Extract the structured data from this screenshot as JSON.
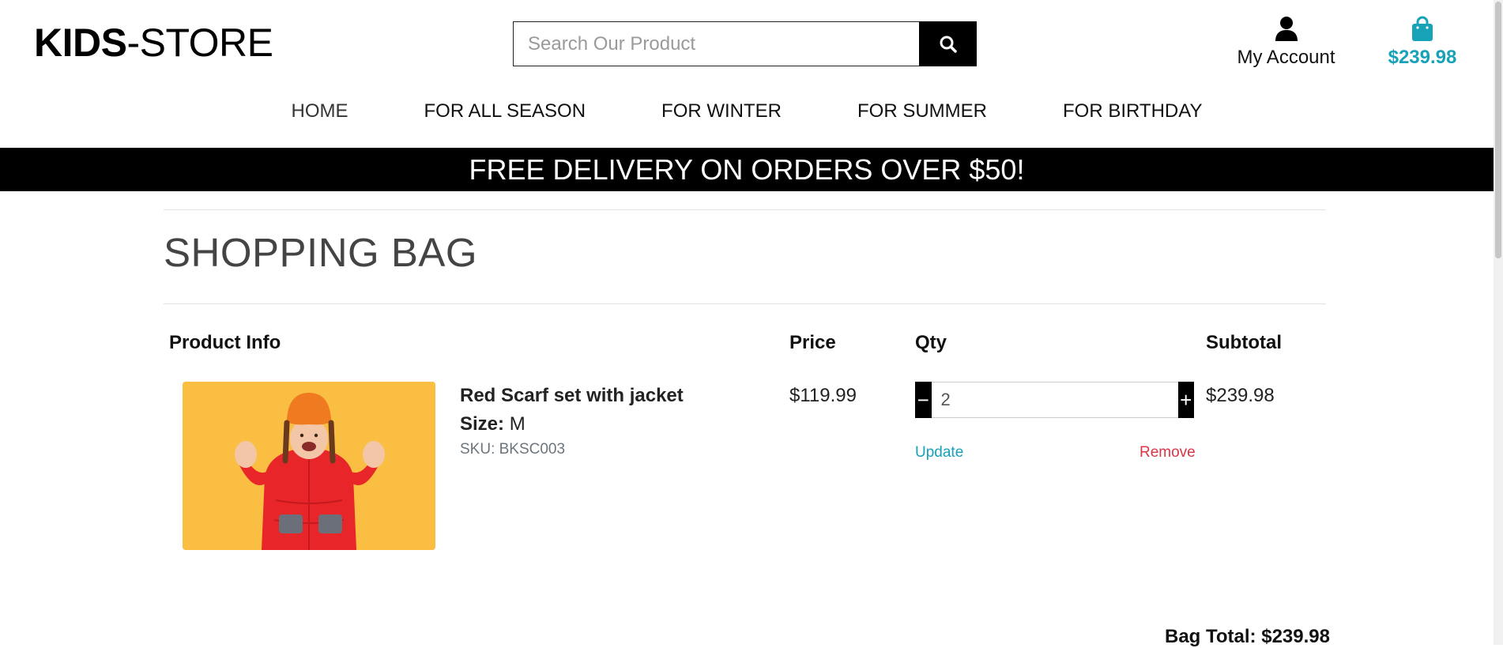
{
  "header": {
    "logo_bold": "KIDS",
    "logo_rest": "-STORE",
    "search_placeholder": "Search Our Product",
    "account_label": "My Account",
    "cart_total": "$239.98",
    "accent_color": "#17a2b8"
  },
  "nav": {
    "items": [
      {
        "label": "HOME"
      },
      {
        "label": "FOR ALL SEASON"
      },
      {
        "label": "FOR WINTER"
      },
      {
        "label": "FOR SUMMER"
      },
      {
        "label": "FOR BIRTHDAY"
      }
    ]
  },
  "banner": {
    "text": "FREE DELIVERY ON ORDERS OVER $50!"
  },
  "bag": {
    "title": "SHOPPING BAG",
    "columns": {
      "product_info": "Product Info",
      "price": "Price",
      "qty": "Qty",
      "subtotal": "Subtotal"
    },
    "items": [
      {
        "name": "Red Scarf set with jacket",
        "size_label": "Size:",
        "size_value": "M",
        "sku": "SKU: BKSC003",
        "price": "$119.99",
        "qty": "2",
        "minus_label": "−",
        "plus_label": "+",
        "update_label": "Update",
        "remove_label": "Remove",
        "subtotal": "$239.98"
      }
    ],
    "bag_total": "Bag Total: $239.98"
  },
  "icons": {
    "search": "search-icon",
    "account": "user-icon",
    "cart": "shopping-bag-icon"
  }
}
